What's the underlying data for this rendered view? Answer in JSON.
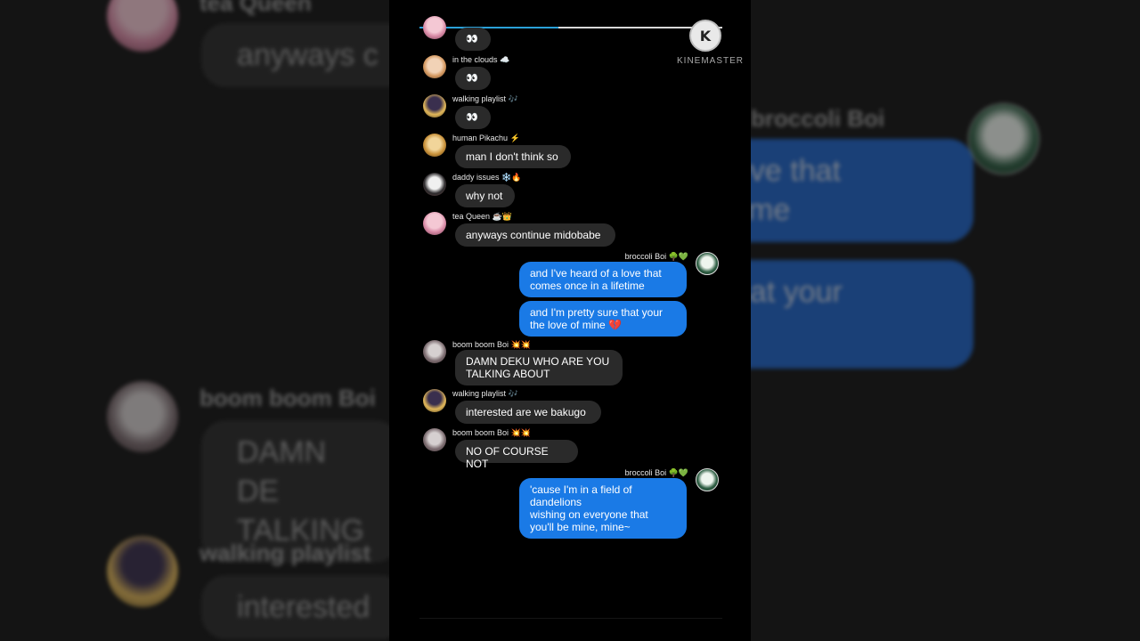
{
  "background": {
    "left": {
      "name_1": "tea Queen",
      "bubble_1": "anyways c",
      "name_2": "boom boom Boi",
      "bubble_2": "DAMN DE\nTALKING",
      "name_3": "walking playlist",
      "bubble_3": "interested"
    },
    "right": {
      "name_1": "broccoli Boi",
      "bubble_1": "ove that\ntime",
      "bubble_2": "hat your"
    }
  },
  "player": {
    "progress": 0.46,
    "watermark": "KINEMASTER",
    "logo_letter": "K"
  },
  "messages": [
    {
      "side": "left",
      "user": "",
      "avatar": "av-pink",
      "text": "👀"
    },
    {
      "side": "left",
      "user": "in the clouds ☁️",
      "avatar": "av-cloud",
      "text": "👀"
    },
    {
      "side": "left",
      "user": "walking playlist 🎶",
      "avatar": "av-walk",
      "text": "👀"
    },
    {
      "side": "left",
      "user": "human Pikachu ⚡",
      "avatar": "av-pika",
      "text": "man I don't think so"
    },
    {
      "side": "left",
      "user": "daddy issues ❄️🔥",
      "avatar": "av-daddy",
      "text": "why not"
    },
    {
      "side": "left",
      "user": "tea Queen ☕👑",
      "avatar": "av-pink",
      "text": "anyways continue midobabe"
    },
    {
      "side": "right",
      "user": "broccoli Boi 🌳💚",
      "avatar": "av-deku",
      "text": "and I've heard of a love that\ncomes once in a lifetime"
    },
    {
      "side": "right",
      "user": "",
      "avatar": "",
      "text": "and I'm pretty sure that your\nthe love of mine 💔"
    },
    {
      "side": "left",
      "user": "boom boom Boi 💥💥",
      "avatar": "av-boom",
      "text": "DAMN DEKU WHO ARE YOU\nTALKING ABOUT"
    },
    {
      "side": "left",
      "user": "walking playlist 🎶",
      "avatar": "av-walk",
      "text": "interested are we bakugo"
    },
    {
      "side": "left",
      "user": "boom boom Boi 💥💥",
      "avatar": "av-boom",
      "text": "NO OF COURSE NOT"
    },
    {
      "side": "right",
      "user": "broccoli Boi 🌳💚",
      "avatar": "av-deku",
      "text": "'cause I'm in a field of\ndandelions\nwishing on everyone that\nyou'll be mine, mine~"
    }
  ]
}
